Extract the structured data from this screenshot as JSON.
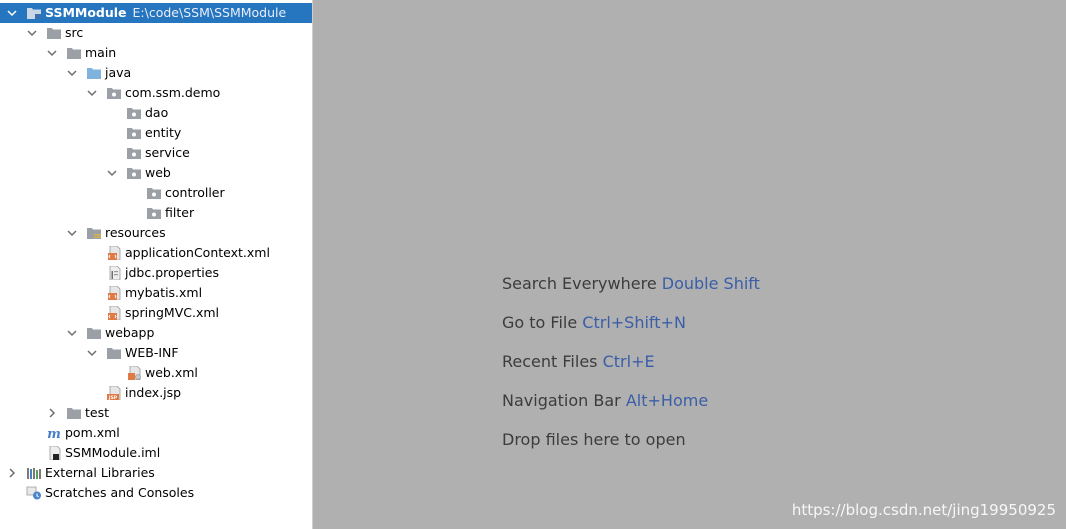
{
  "tree": {
    "root": {
      "name": "SSMModule",
      "path": "E:\\code\\SSM\\SSMModule"
    },
    "src": "src",
    "main": "main",
    "java": "java",
    "package": "com.ssm.demo",
    "dao": "dao",
    "entity": "entity",
    "service": "service",
    "web": "web",
    "controller": "controller",
    "filter": "filter",
    "resources": "resources",
    "applicationContext": "applicationContext.xml",
    "jdbc": "jdbc.properties",
    "mybatis": "mybatis.xml",
    "springMVC": "springMVC.xml",
    "webapp": "webapp",
    "webinf": "WEB-INF",
    "webxml": "web.xml",
    "indexjsp": "index.jsp",
    "test": "test",
    "pom": "pom.xml",
    "iml": "SSMModule.iml",
    "external": "External Libraries",
    "scratches": "Scratches and Consoles"
  },
  "hints": [
    {
      "text": "Search Everywhere",
      "key": "Double Shift"
    },
    {
      "text": "Go to File",
      "key": "Ctrl+Shift+N"
    },
    {
      "text": "Recent Files",
      "key": "Ctrl+E"
    },
    {
      "text": "Navigation Bar",
      "key": "Alt+Home"
    },
    {
      "text": "Drop files here to open",
      "key": ""
    }
  ],
  "watermark": "https://blog.csdn.net/jing19950925",
  "colors": {
    "selection": "#2675bf",
    "editor_bg": "#b0b0b0",
    "shortcut": "#3a5ea8"
  }
}
